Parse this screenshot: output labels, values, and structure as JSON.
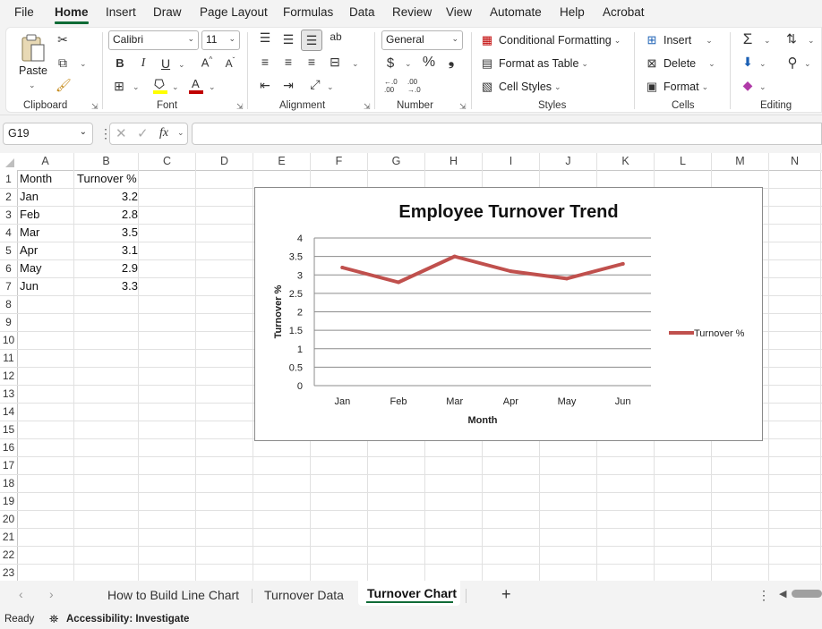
{
  "menu": {
    "items": [
      "File",
      "Home",
      "Insert",
      "Draw",
      "Page Layout",
      "Formulas",
      "Data",
      "Review",
      "View",
      "Automate",
      "Help",
      "Acrobat"
    ],
    "active": "Home"
  },
  "ribbon": {
    "clipboard": {
      "paste": "Paste",
      "label": "Clipboard"
    },
    "font": {
      "name": "Calibri",
      "size": "11",
      "label": "Font"
    },
    "alignment": {
      "label": "Alignment"
    },
    "number": {
      "format": "General",
      "label": "Number",
      "dec_inc": ".0",
      "dec_inc2": ".00",
      "dec_dec": ".00",
      "dec_dec2": ".0"
    },
    "styles": {
      "conditional": "Conditional Formatting",
      "table": "Format as Table",
      "cell": "Cell Styles",
      "label": "Styles"
    },
    "cells": {
      "insert": "Insert",
      "delete": "Delete",
      "format": "Format",
      "label": "Cells"
    },
    "editing": {
      "label": "Editing"
    }
  },
  "formula_bar": {
    "name_box": "G19",
    "formula": ""
  },
  "sheet": {
    "columns": [
      "A",
      "B",
      "C",
      "D",
      "E",
      "F",
      "G",
      "H",
      "I",
      "J",
      "K",
      "L",
      "M",
      "N"
    ],
    "rows": [
      "1",
      "2",
      "3",
      "4",
      "5",
      "6",
      "7",
      "8",
      "9",
      "10",
      "11",
      "12",
      "13",
      "14",
      "15",
      "16",
      "17",
      "18",
      "19",
      "20",
      "21",
      "22",
      "23"
    ],
    "headers": {
      "a": "Month",
      "b": "Turnover %"
    },
    "data": [
      {
        "month": "Jan",
        "value": "3.2"
      },
      {
        "month": "Feb",
        "value": "2.8"
      },
      {
        "month": "Mar",
        "value": "3.5"
      },
      {
        "month": "Apr",
        "value": "3.1"
      },
      {
        "month": "May",
        "value": "2.9"
      },
      {
        "month": "Jun",
        "value": "3.3"
      }
    ]
  },
  "chart_data": {
    "type": "line",
    "title": "Employee Turnover Trend",
    "xlabel": "Month",
    "ylabel": "Turnover %",
    "categories": [
      "Jan",
      "Feb",
      "Mar",
      "Apr",
      "May",
      "Jun"
    ],
    "series": [
      {
        "name": "Turnover %",
        "values": [
          3.2,
          2.8,
          3.5,
          3.1,
          2.9,
          3.3
        ],
        "color": "#c0504d"
      }
    ],
    "ylim": [
      0,
      4
    ],
    "yticks": [
      "0",
      "0.5",
      "1",
      "1.5",
      "2",
      "2.5",
      "3",
      "3.5",
      "4"
    ],
    "grid": true,
    "legend": "right"
  },
  "tabs": {
    "items": [
      "How to Build Line Chart",
      "Turnover Data",
      "Turnover Chart"
    ],
    "active": "Turnover Chart",
    "add": "+"
  },
  "status": {
    "ready": "Ready",
    "accessibility": "Accessibility: Investigate"
  },
  "colors": {
    "accent": "#0f6b36",
    "series": "#c0504d"
  }
}
